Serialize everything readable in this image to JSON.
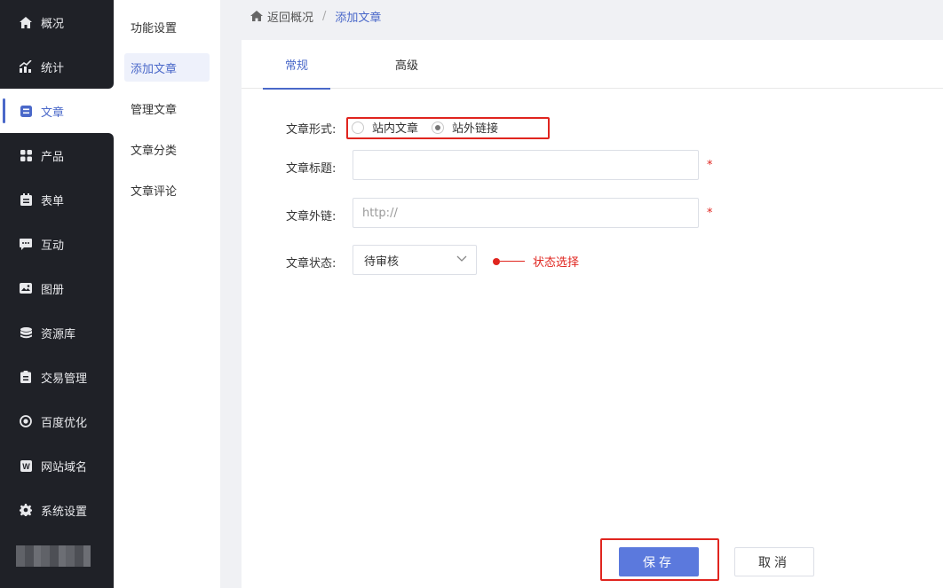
{
  "sidebar": {
    "items": [
      {
        "label": "概况",
        "icon": "home-icon"
      },
      {
        "label": "统计",
        "icon": "stats-icon"
      },
      {
        "label": "文章",
        "icon": "article-icon"
      },
      {
        "label": "产品",
        "icon": "products-icon"
      },
      {
        "label": "表单",
        "icon": "form-icon"
      },
      {
        "label": "互动",
        "icon": "chat-icon"
      },
      {
        "label": "图册",
        "icon": "gallery-icon"
      },
      {
        "label": "资源库",
        "icon": "database-icon"
      },
      {
        "label": "交易管理",
        "icon": "clipboard-icon"
      },
      {
        "label": "百度优化",
        "icon": "seo-icon"
      },
      {
        "label": "网站域名",
        "icon": "domain-icon"
      },
      {
        "label": "系统设置",
        "icon": "gear-icon"
      }
    ],
    "active_index": 2
  },
  "submenu": {
    "items": [
      "功能设置",
      "添加文章",
      "管理文章",
      "文章分类",
      "文章评论"
    ],
    "active_index": 1
  },
  "breadcrumb": {
    "back": "返回概况",
    "separator": "/",
    "current": "添加文章"
  },
  "tabs": {
    "items": [
      "常规",
      "高级"
    ],
    "active_index": 0
  },
  "form": {
    "type_label": "文章形式:",
    "type_options": [
      "站内文章",
      "站外链接"
    ],
    "type_selected_index": 1,
    "title_label": "文章标题:",
    "title_value": "",
    "link_label": "文章外链:",
    "link_placeholder": "http://",
    "required_mark": "*",
    "status_label": "文章状态:",
    "status_value": "待审核",
    "status_annotation": "状态选择"
  },
  "actions": {
    "save": "保存",
    "cancel": "取消"
  },
  "colors": {
    "accent": "#4a68c9",
    "primary_button": "#5b79dd",
    "sidebar_bg": "#1f2127",
    "highlight_red": "#e0251f"
  }
}
